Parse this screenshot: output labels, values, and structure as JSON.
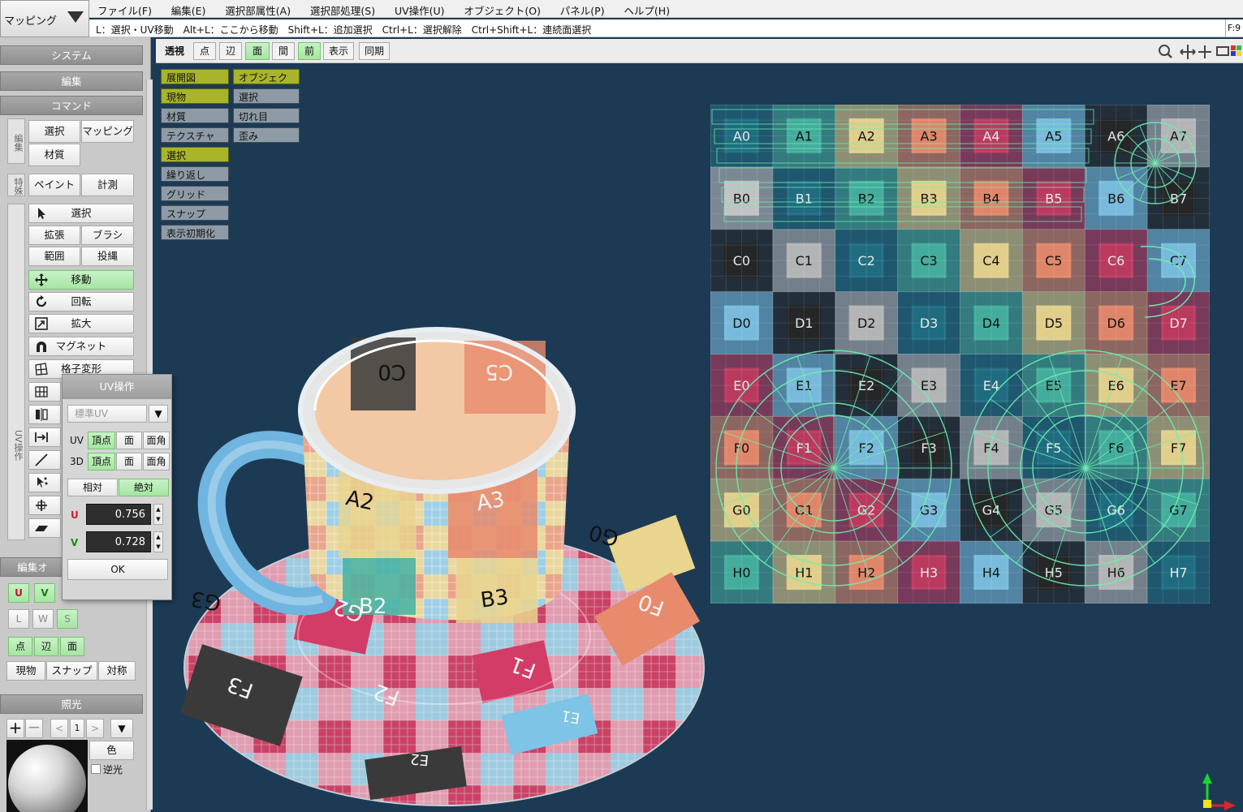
{
  "mode_selector": {
    "label": "マッピング"
  },
  "menu": [
    "ファイル(F)",
    "編集(E)",
    "選択部属性(A)",
    "選択部処理(S)",
    "UV操作(U)",
    "オブジェクト(O)",
    "パネル(P)",
    "ヘルプ(H)"
  ],
  "hint": {
    "text": "L：選択・UV移動　Alt+L：ここから移動　Shift+L：追加選択　Ctrl+L：選択解除　Ctrl+Shift+L：連続面選択",
    "frame_label": "F:9"
  },
  "left_panel": {
    "system": "システム",
    "edit": "編集",
    "command": "コマンド",
    "group_edit": "編集",
    "group_special": "特殊",
    "group_uv": "UV操作",
    "select": "選択",
    "mapping": "マッピング",
    "material": "材質",
    "paint": "ペイント",
    "measure": "計測",
    "tool_select": "選択",
    "expand": "拡張",
    "brush": "ブラシ",
    "range": "範囲",
    "project": "投縄",
    "move": "移動",
    "rotate": "回転",
    "scale": "拡大",
    "magnet": "マグネット",
    "lattice": "格子変形",
    "edit_option": "編集オ",
    "u_label": "U",
    "v_label": "V",
    "l_label": "L",
    "w_label": "W",
    "s_label": "S",
    "pt": "点",
    "edge": "辺",
    "face": "面",
    "current": "現物",
    "snap": "スナップ",
    "symmetry": "対称",
    "lighting": "照光",
    "light_num": "1",
    "color": "色",
    "reverse": "逆光"
  },
  "view_toolbar": [
    "透視",
    "点",
    "辺",
    "面",
    "間",
    "前",
    "表示",
    "同期"
  ],
  "overlay_left": [
    "展開図",
    "現物",
    "材質",
    "テクスチャ",
    "選択",
    "繰り返し",
    "グリッド",
    "スナップ",
    "表示初期化"
  ],
  "overlay_right": [
    "オブジェクト",
    "選択",
    "切れ目",
    "歪み"
  ],
  "uv_panel": {
    "title": "UV操作",
    "dropdown": "標準UV",
    "uv_row": "UV",
    "d3_row": "3D",
    "vertex": "頂点",
    "face": "面",
    "corner": "面角",
    "relative": "相対",
    "absolute": "絶対",
    "u": "U",
    "v": "V",
    "u_value": "0.756",
    "v_value": "0.728",
    "ok": "OK"
  },
  "colors": {
    "viewport_bg": "#1d3a55",
    "active_green": "#a6e5a2",
    "overlay_on": "#a9b42a",
    "overlay_off": "#8e9ba6",
    "wire": "#6ef0b0"
  },
  "uv_grid": {
    "rows": [
      "A",
      "B",
      "C",
      "D",
      "E",
      "F",
      "G",
      "H"
    ],
    "cols": 8,
    "palette": {
      "A": [
        "#1f6f83",
        "#45b1a0",
        "#e9d58e",
        "#e88a6c",
        "#c13b5f",
        "#7cc0e1",
        "#262626",
        "#b9b9b9"
      ],
      "B": [
        "#c9c9c9",
        "#1f6f83",
        "#45b1a0",
        "#e9d58e",
        "#e88a6c",
        "#c13b5f",
        "#7cc0e1",
        "#262626"
      ],
      "C": [
        "#262626",
        "#b9b9b9",
        "#1f6f83",
        "#45b1a0",
        "#e9d58e",
        "#e88a6c",
        "#c13b5f",
        "#7cc0e1"
      ],
      "D": [
        "#7cc0e1",
        "#262626",
        "#b9b9b9",
        "#1f6f83",
        "#45b1a0",
        "#e9d58e",
        "#e88a6c",
        "#c13b5f"
      ],
      "E": [
        "#c13b5f",
        "#7cc0e1",
        "#262626",
        "#b9b9b9",
        "#1f6f83",
        "#45b1a0",
        "#e9d58e",
        "#e88a6c"
      ],
      "F": [
        "#e88a6c",
        "#c13b5f",
        "#7cc0e1",
        "#262626",
        "#b9b9b9",
        "#1f6f83",
        "#45b1a0",
        "#e9d58e"
      ],
      "G": [
        "#e9d58e",
        "#e88a6c",
        "#c13b5f",
        "#7cc0e1",
        "#262626",
        "#b9b9b9",
        "#1f6f83",
        "#45b1a0"
      ],
      "H": [
        "#45b1a0",
        "#e9d58e",
        "#e88a6c",
        "#c13b5f",
        "#7cc0e1",
        "#262626",
        "#b9b9b9",
        "#1f6f83"
      ]
    }
  },
  "cup_labels": [
    "C0",
    "C5",
    "A2",
    "A3",
    "B2",
    "B3",
    "G0",
    "F0",
    "G2",
    "G3",
    "F1",
    "F2",
    "F3",
    "E1",
    "E2"
  ]
}
